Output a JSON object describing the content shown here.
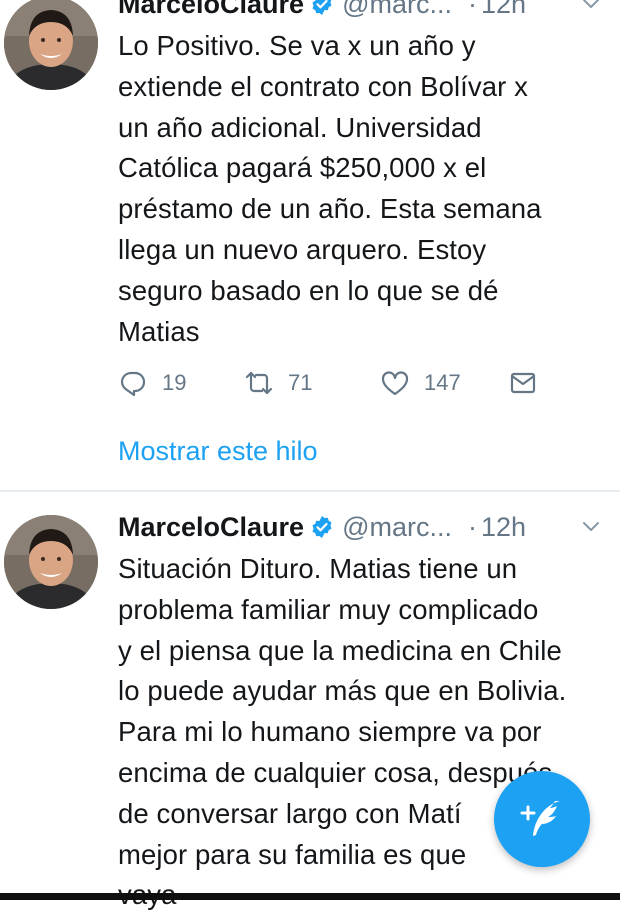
{
  "tweets": [
    {
      "author_name": "MarceloClaure",
      "handle": "@marc...",
      "separator": "·",
      "time": "12h",
      "text": "Lo Positivo. Se va x un año y\nextiende el contrato con Bolívar x\nun año adicional. Universidad\nCatólica pagará $250,000 x el\npréstamo de un año. Esta semana\nllega un nuevo arquero.  Estoy\nseguro basado en lo que se dé\nMatias",
      "replies": "19",
      "retweets": "71",
      "likes": "147",
      "thread_link": "Mostrar este hilo"
    },
    {
      "author_name": "MarceloClaure",
      "handle": "@marc...",
      "separator": "·",
      "time": "12h",
      "text": "Situación Dituro. Matias tiene un\nproblema familiar muy complicado\ny el piensa que la medicina en Chile\nlo puede ayudar más que en Bolivia.\nPara mi lo humano siempre va por\nencima de cualquier cosa, después\nde conversar largo con Matí\nmejor para su familia es que\nvaya"
    }
  ],
  "colors": {
    "accent": "#1da1f2",
    "text": "#14171a",
    "secondary": "#657786",
    "divider": "#e6ecf0"
  },
  "icons": {
    "verified": "verified-badge-icon",
    "menu": "chevron-down-icon",
    "reply": "reply-icon",
    "retweet": "retweet-icon",
    "like": "heart-icon",
    "dm": "envelope-icon",
    "compose": "compose-tweet-icon"
  }
}
